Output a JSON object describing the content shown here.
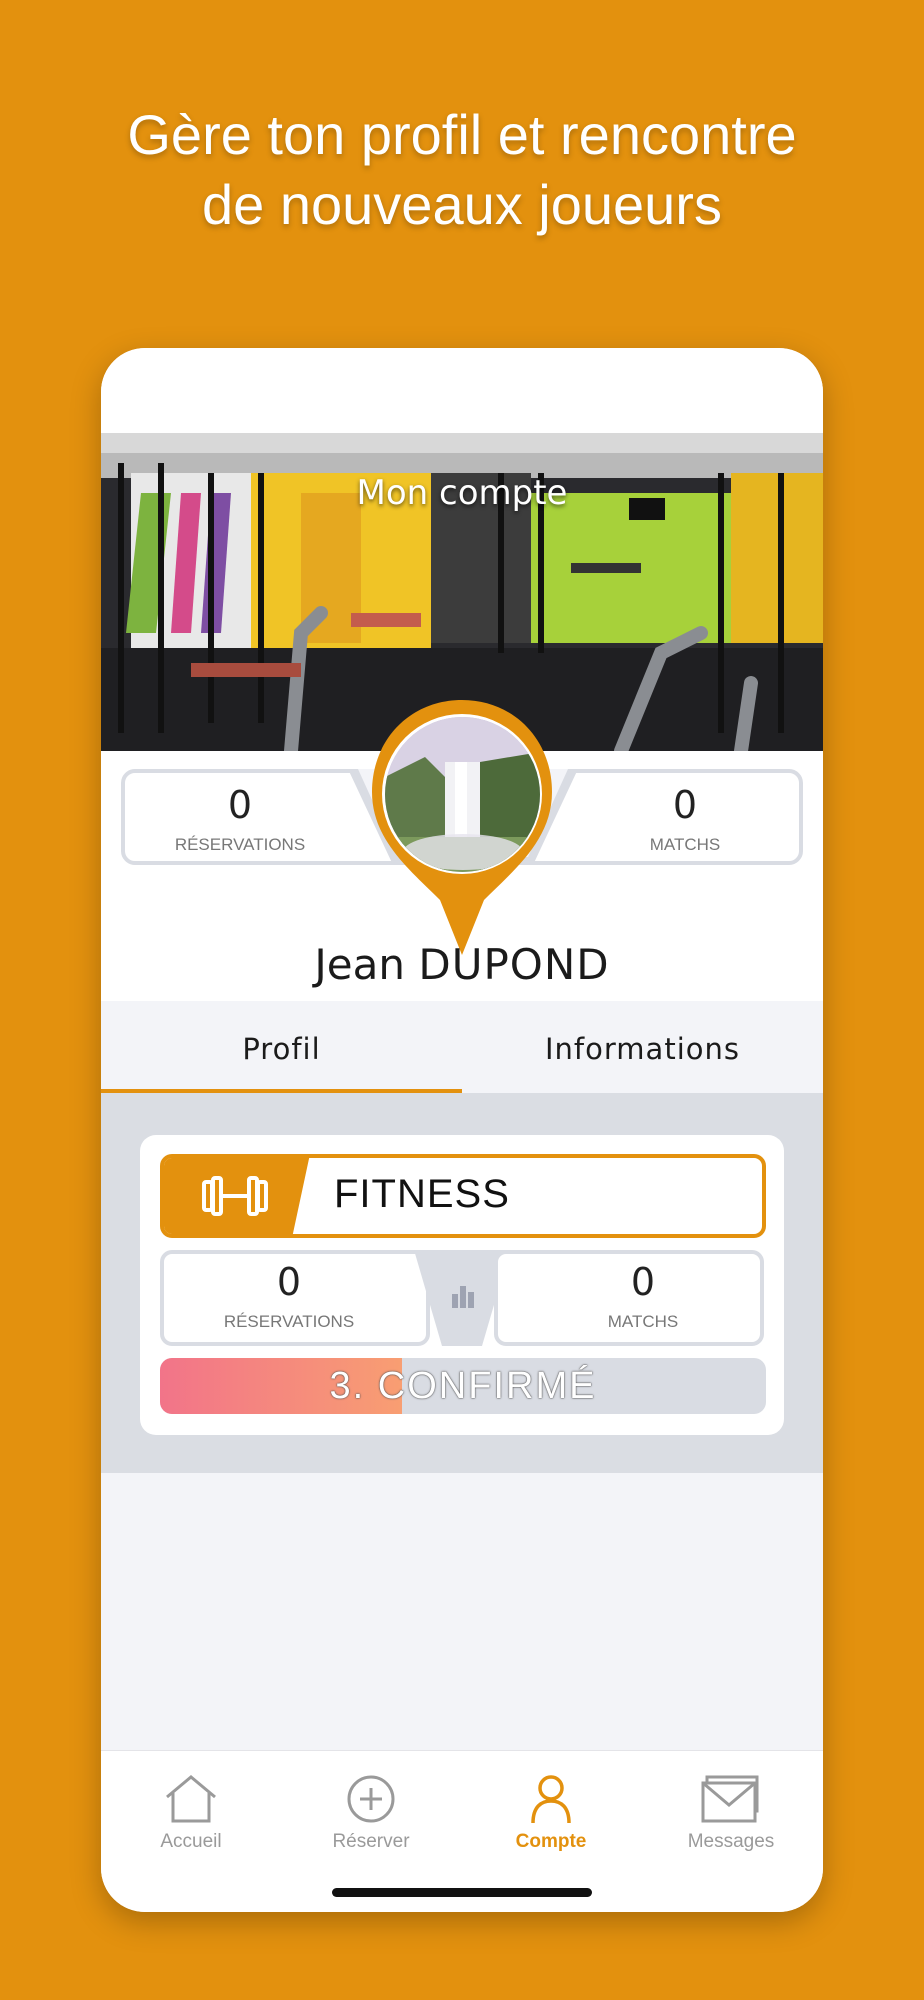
{
  "headline": {
    "line1": "Gère ton profil et rencontre",
    "line2": "de nouveaux joueurs"
  },
  "hero": {
    "title": "Mon compte"
  },
  "stats": {
    "reservations": {
      "value": "0",
      "label": "RÉSERVATIONS"
    },
    "matchs": {
      "value": "0",
      "label": "MATCHS"
    }
  },
  "user": {
    "first_name": "Jean",
    "last_name": "DUPOND"
  },
  "tabs": [
    {
      "label": "Profil",
      "active": true
    },
    {
      "label": "Informations",
      "active": false
    }
  ],
  "sport_card": {
    "sport": "FITNESS",
    "icon": "dumbbell-icon",
    "reservations": {
      "value": "0",
      "label": "RÉSERVATIONS"
    },
    "matchs": {
      "value": "0",
      "label": "MATCHS"
    },
    "level": {
      "label": "3. CONFIRMÉ",
      "progress": 0.4
    }
  },
  "nav": [
    {
      "label": "Accueil",
      "icon": "home-icon",
      "active": false
    },
    {
      "label": "Réserver",
      "icon": "plus-circle-icon",
      "active": false
    },
    {
      "label": "Compte",
      "icon": "user-icon",
      "active": true
    },
    {
      "label": "Messages",
      "icon": "envelope-icon",
      "active": false
    }
  ],
  "colors": {
    "accent": "#E3910E",
    "background": "#E3910E",
    "level_gradient_start": "#F27489",
    "level_gradient_end": "#F89E72"
  }
}
